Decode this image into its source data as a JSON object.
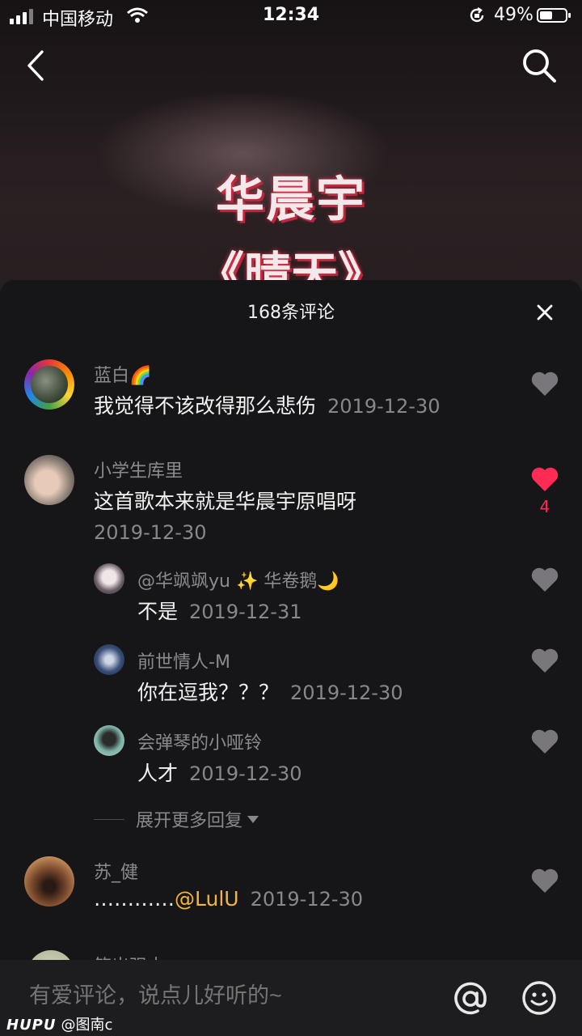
{
  "status_bar": {
    "carrier": "中国移动",
    "time": "12:34",
    "battery_percent": "49%",
    "battery_level": 0.49
  },
  "video": {
    "title": "华晨宇",
    "subtitle": "《晴天》"
  },
  "comments_panel": {
    "header": "168条评论",
    "comments": [
      {
        "author": "蓝白🌈",
        "text": "我觉得不该改得那么悲伤",
        "date": "2019-12-30",
        "liked": false
      },
      {
        "author": "小学生库里",
        "text": "这首歌本来就是华晨宇原唱呀",
        "date": "2019-12-30",
        "liked": true,
        "like_count": "4",
        "replies": [
          {
            "author": "@华飒飒yu ✨ 华卷鹅🌙",
            "text": "不是",
            "date": "2019-12-31",
            "liked": false
          },
          {
            "author": "前世情人-M",
            "text": "你在逗我？？？",
            "date": "2019-12-30",
            "liked": false
          },
          {
            "author": "会弹琴的小哑铃",
            "text": "人才",
            "date": "2019-12-30",
            "liked": false
          }
        ],
        "expand_label": "展开更多回复"
      },
      {
        "author": "苏_健",
        "text_prefix": "…………",
        "mention": "@LulU",
        "date": "2019-12-30",
        "liked": false
      },
      {
        "author": "筑出强大"
      }
    ]
  },
  "input_bar": {
    "placeholder": "有爱评论，说点儿好听的~"
  },
  "watermark": {
    "brand": "HUPU",
    "user": "@图南c"
  },
  "colors": {
    "liked": "#fe2c55",
    "mention": "#f3b53a"
  }
}
